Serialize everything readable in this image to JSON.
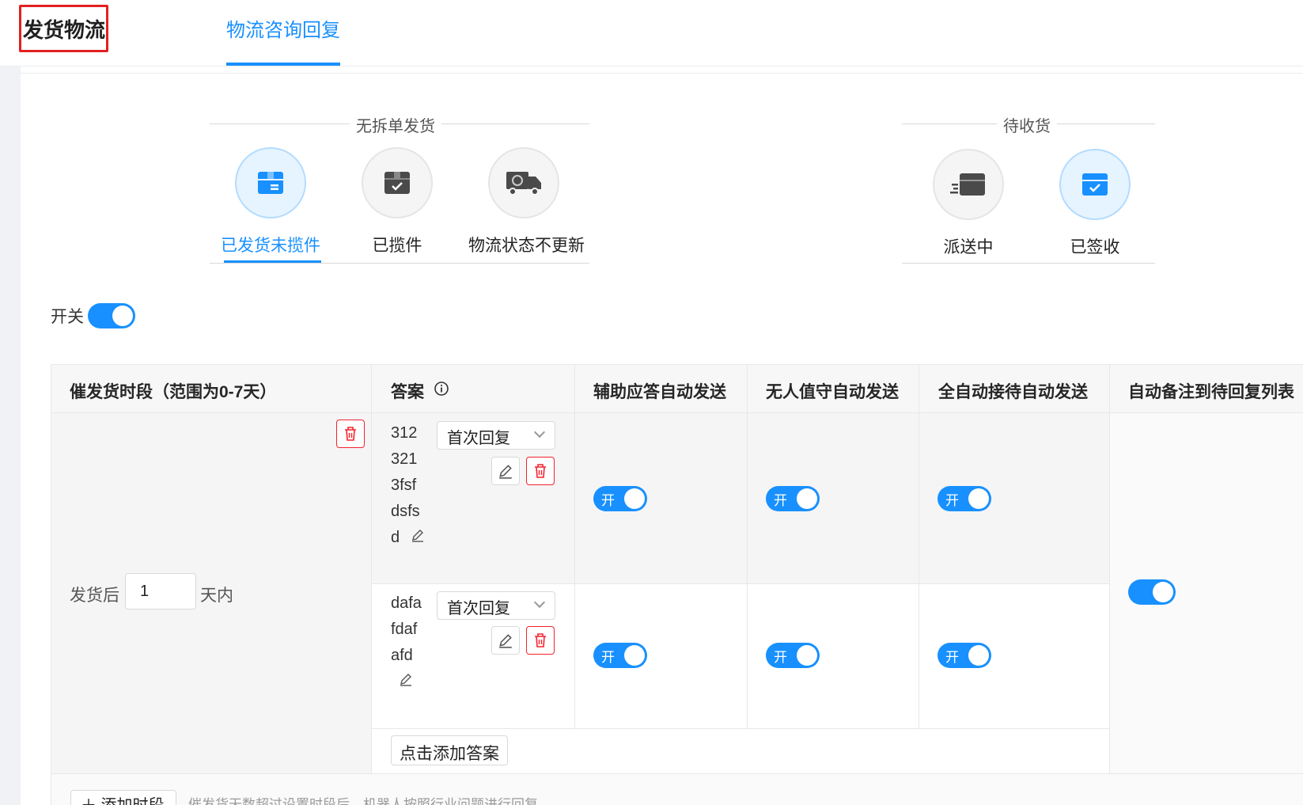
{
  "header": {
    "app_title": "发货物流",
    "tab_label": "物流咨询回复"
  },
  "groups": {
    "no_split": {
      "title": "无拆单发货"
    },
    "pending_receipt": {
      "title": "待收货"
    }
  },
  "stages": [
    {
      "label": "已发货未揽件",
      "icon": "box-icon",
      "active": true
    },
    {
      "label": "已揽件",
      "icon": "box-check-icon",
      "active": false
    },
    {
      "label": "物流状态不更新",
      "icon": "truck-icon",
      "active": false
    },
    {
      "label": "派送中",
      "icon": "delivering-icon",
      "active": false
    },
    {
      "label": "已签收",
      "icon": "signed-icon",
      "active": true
    }
  ],
  "switch": {
    "label": "开关",
    "on": true
  },
  "table": {
    "headers": {
      "period": "催发货时段（范围为0-7天）",
      "answer": "答案",
      "assist": "辅助应答自动发送",
      "unattended": "无人值守自动发送",
      "full_auto": "全自动接待自动发送",
      "auto_note": "自动备注到待回复列表"
    },
    "period": {
      "prefix": "发货后",
      "value": "1",
      "suffix": "天内"
    },
    "answers": [
      {
        "lines": [
          "312",
          "321",
          "3fsf",
          "dsfs",
          "d"
        ],
        "type": "首次回复",
        "toggle_text": "开"
      },
      {
        "lines": [
          "dafa",
          "fdaf",
          "afd"
        ],
        "type": "首次回复",
        "toggle_text": "开"
      }
    ],
    "add_answer": "点击添加答案",
    "add_period": "＋ 添加时段",
    "hint": "催发货天数超过设置时段后，机器人按照行业问题进行回复"
  },
  "colors": {
    "accent": "#1890ff",
    "danger": "#f5222d"
  }
}
